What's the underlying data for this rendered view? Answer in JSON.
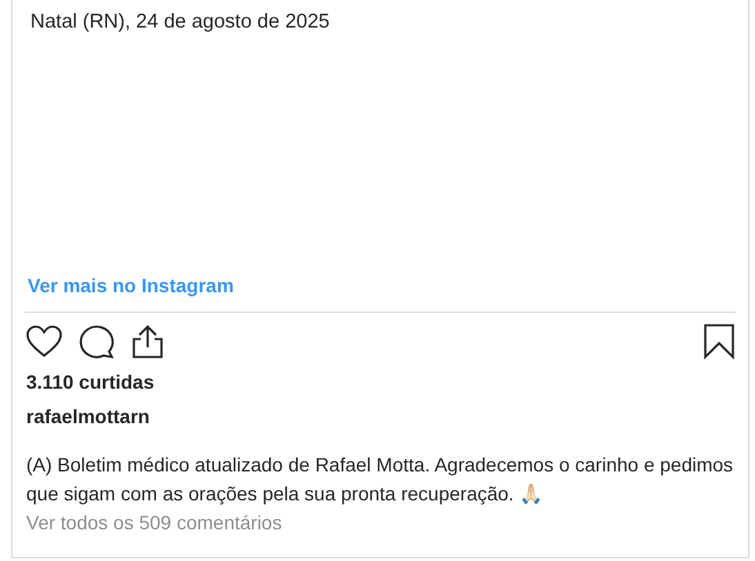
{
  "post_text": "Natal (RN), 24 de agosto de 2025",
  "view_more_link": "Ver mais no Instagram",
  "likes": "3.110 curtidas",
  "username": "rafaelmottarn",
  "caption": "(A) Boletim médico atualizado de Rafael Motta. Agradecemos o carinho e pedimos que sigam com as orações pela sua pronta recuperação. 🙏🏻",
  "comments_link": "Ver todos os 509 comentários"
}
